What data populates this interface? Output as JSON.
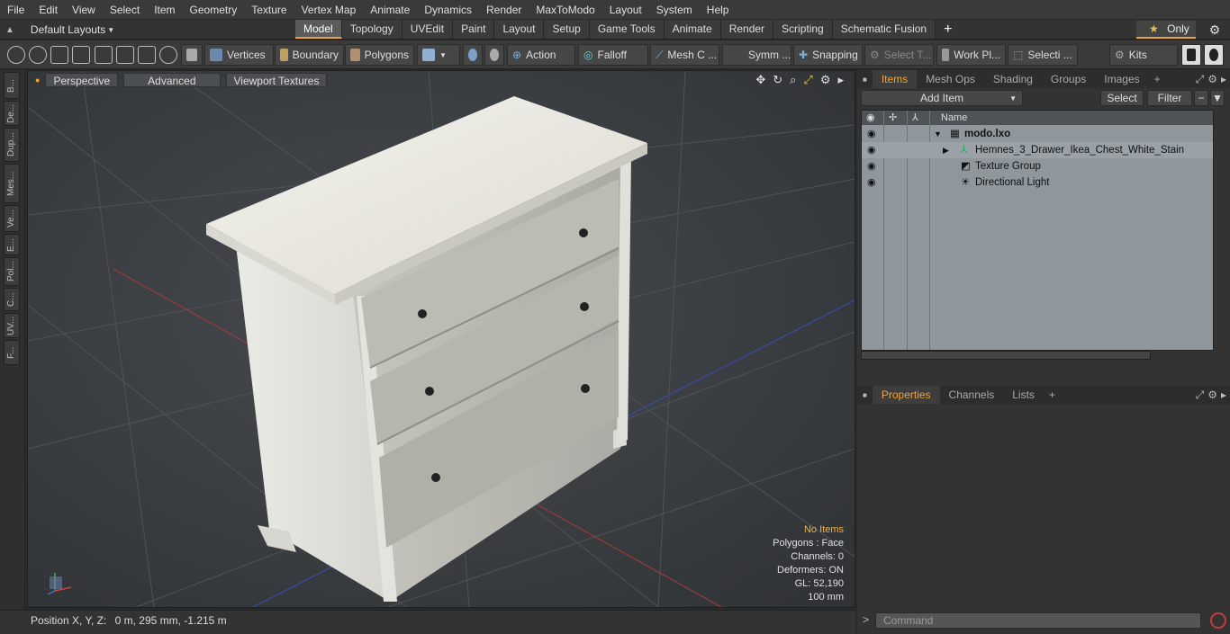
{
  "menu": [
    "File",
    "Edit",
    "View",
    "Select",
    "Item",
    "Geometry",
    "Texture",
    "Vertex Map",
    "Animate",
    "Dynamics",
    "Render",
    "MaxToModo",
    "Layout",
    "System",
    "Help"
  ],
  "layouts_label": "Default Layouts",
  "tabs": [
    "Model",
    "Topology",
    "UVEdit",
    "Paint",
    "Layout",
    "Setup",
    "Game Tools",
    "Animate",
    "Render",
    "Scripting",
    "Schematic Fusion"
  ],
  "active_tab": "Model",
  "only_label": "Only",
  "toolbar": {
    "vertices": "Vertices",
    "boundary": "Boundary",
    "polygons": "Polygons",
    "action": "Action",
    "falloff": "Falloff",
    "mesh": "Mesh C ...",
    "symm": "Symm ...",
    "snapping": "Snapping",
    "select_t": "Select T...",
    "work_pl": "Work Pl...",
    "selecti": "Selecti ...",
    "kits": "Kits"
  },
  "left_tabs": [
    "B...",
    "De...",
    "Dup...",
    "Mes...",
    "Ve...",
    "E...",
    "Pol...",
    "C...",
    "UV...",
    "F..."
  ],
  "viewport": {
    "buttons": [
      "Perspective",
      "Advanced",
      "Viewport Textures"
    ],
    "info": [
      "No Items",
      "Polygons : Face",
      "Channels: 0",
      "Deformers: ON",
      "GL: 52,190",
      "100 mm"
    ]
  },
  "status": {
    "label": "Position X, Y, Z:",
    "value": "0 m, 295 mm, -1.215 m"
  },
  "panel_tabs": [
    "Items",
    "Mesh Ops",
    "Shading",
    "Groups",
    "Images"
  ],
  "add_item": "Add Item",
  "select_btn": "Select",
  "filter_btn": "Filter",
  "tree": {
    "name_header": "Name",
    "rows": [
      "modo.lxo",
      "Hemnes_3_Drawer_Ikea_Chest_White_Stain",
      "Texture Group",
      "Directional Light"
    ]
  },
  "props_tabs": [
    "Properties",
    "Channels",
    "Lists"
  ],
  "command_placeholder": "Command",
  "colors": {
    "accent": "#e9a53a",
    "viewport_bg": "#3d4043",
    "tree_bg": "#8f969c"
  }
}
